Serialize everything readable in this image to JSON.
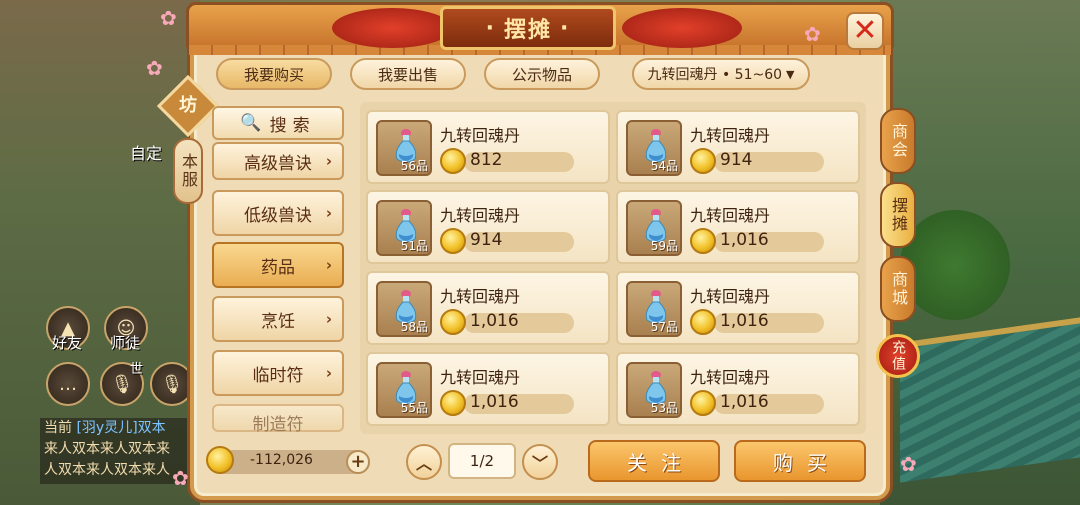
{
  "window": {
    "title": "摆摊"
  },
  "top_tabs": [
    {
      "label": "我要购买",
      "active": true
    },
    {
      "label": "我要出售",
      "active": false
    },
    {
      "label": "公示物品",
      "active": false
    }
  ],
  "filter": {
    "label": "九转回魂丹 • 51~60"
  },
  "side": {
    "fang": "坊",
    "server": "本服",
    "search_label": "搜索",
    "categories": [
      {
        "label": "高级兽诀",
        "active": false
      },
      {
        "label": "低级兽诀",
        "active": false
      },
      {
        "label": "药品",
        "active": true
      },
      {
        "label": "烹饪",
        "active": false
      },
      {
        "label": "临时符",
        "active": false
      },
      {
        "label": "制造符",
        "active": false
      }
    ]
  },
  "items": [
    {
      "name": "九转回魂丹",
      "quality": "56品",
      "price": "812"
    },
    {
      "name": "九转回魂丹",
      "quality": "54品",
      "price": "914"
    },
    {
      "name": "九转回魂丹",
      "quality": "51品",
      "price": "914"
    },
    {
      "name": "九转回魂丹",
      "quality": "59品",
      "price": "1,016"
    },
    {
      "name": "九转回魂丹",
      "quality": "58品",
      "price": "1,016"
    },
    {
      "name": "九转回魂丹",
      "quality": "57品",
      "price": "1,016"
    },
    {
      "name": "九转回魂丹",
      "quality": "55品",
      "price": "1,016"
    },
    {
      "name": "九转回魂丹",
      "quality": "53品",
      "price": "1,016"
    }
  ],
  "right_tabs": [
    {
      "label": "商会",
      "active": false
    },
    {
      "label": "摆摊",
      "active": true
    },
    {
      "label": "商城",
      "active": false
    },
    {
      "label": "充值",
      "active": false
    }
  ],
  "footer": {
    "funds": "-112,026",
    "page": "1/2",
    "follow_label": "关注",
    "buy_label": "购买"
  },
  "world": {
    "name_label": "自定",
    "friends_label": "好友",
    "master_label": "师徒",
    "world_label": "世",
    "chat_lines": [
      {
        "prefix": "当前",
        "text": "[羽y灵儿]双本"
      },
      {
        "prefix": "",
        "text": "来人双本来人双本来"
      },
      {
        "prefix": "",
        "text": "人双本来人双本来人"
      }
    ]
  },
  "colors": {
    "accent": "#e9962e",
    "panel_bg": "#efdcb6",
    "frame": "#8a4f22"
  }
}
